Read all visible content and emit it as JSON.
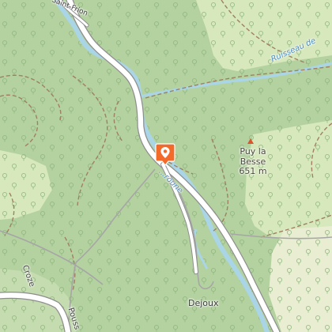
{
  "map": {
    "colors": {
      "forest": "#b4d1a0",
      "meadow": "#d6e8bc",
      "open_land": "#e9eed3",
      "water": "#a9d5e6",
      "road": "#ffffff",
      "road_casing": "#8e8e8e",
      "path": "#a08060",
      "tree_symbol": "#8fb67d",
      "marker": "#f26b2b"
    },
    "labels": {
      "place_saint_frion": "Saint-Frion",
      "stream_ruisseau": "Ruisseau de",
      "river_roune": "...roune",
      "peak_name": "Puy la",
      "peak_name_line2": "Besse",
      "peak_elevation": "651 m",
      "hamlet_dejoux": "Dejoux",
      "road_croze": "Croze",
      "road_pouss": "Pouss"
    },
    "icons": {
      "marker": "location-pin-icon",
      "peak": "peak-triangle-icon",
      "trees": "tree-icon"
    }
  }
}
